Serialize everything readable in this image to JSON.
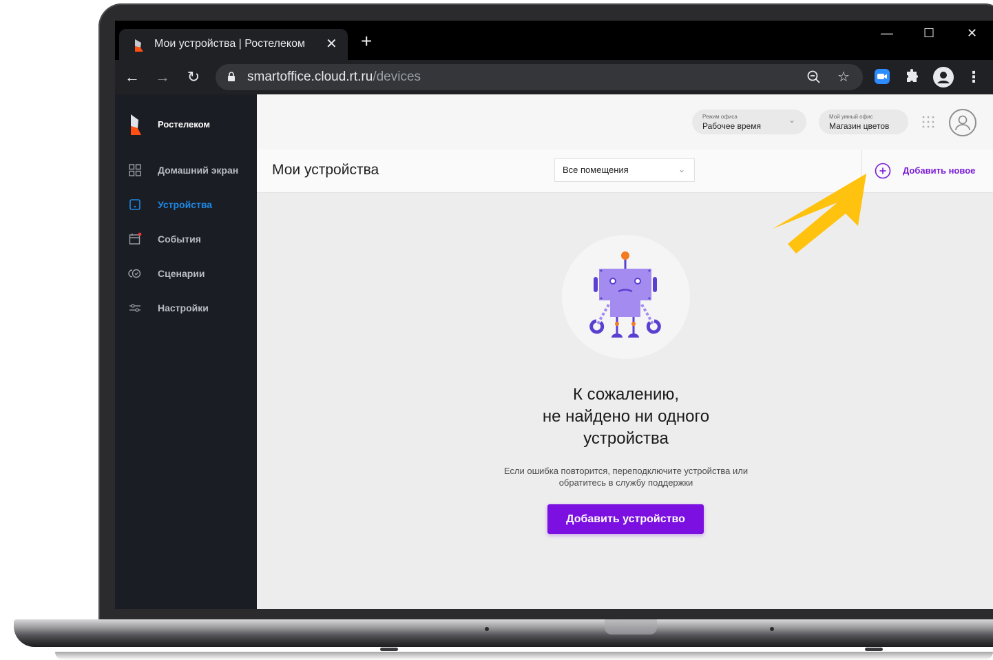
{
  "browser": {
    "tab_title": "Мои устройства | Ростелеком",
    "tab_close": "✕",
    "new_tab": "+",
    "window_controls": {
      "minimize": "—",
      "maximize": "☐",
      "close": "✕"
    },
    "url_host": "smartoffice.cloud.rt.ru",
    "url_path": "/devices",
    "icons": [
      "back-icon",
      "forward-icon",
      "reload-icon",
      "lock-icon",
      "zoom-icon",
      "star-icon",
      "zoom-meetings-icon",
      "extensions-icon",
      "profile-icon",
      "menu-icon"
    ]
  },
  "sidebar": {
    "brand": "Ростелеком",
    "items": [
      {
        "label": "Домашний экран",
        "icon": "grid-icon",
        "active": false
      },
      {
        "label": "Устройства",
        "icon": "device-icon",
        "active": true
      },
      {
        "label": "События",
        "icon": "calendar-icon",
        "active": false
      },
      {
        "label": "Сценарии",
        "icon": "scenario-icon",
        "active": false
      },
      {
        "label": "Настройки",
        "icon": "sliders-icon",
        "active": false
      }
    ]
  },
  "topbar": {
    "office_mode": {
      "caption": "Режим офиса",
      "value": "Рабочее время"
    },
    "my_office": {
      "caption": "Мой умный офис",
      "value": "Магазин цветов"
    }
  },
  "subbar": {
    "title": "Мои устройства",
    "room_select": "Все помещения",
    "add_new": "Добавить новое"
  },
  "empty_state": {
    "title_line1": "К сожалению,",
    "title_line2": "не найдено ни одного",
    "title_line3": "устройства",
    "hint_line1": "Если ошибка повторится, переподключите устройства или",
    "hint_line2": "обратитесь в службу поддержки",
    "button": "Добавить устройство"
  },
  "colors": {
    "accent_purple": "#7b10e0",
    "active_blue": "#1e88e5",
    "sidebar_bg": "#1a1d23",
    "annotation_arrow": "#ffc107"
  }
}
